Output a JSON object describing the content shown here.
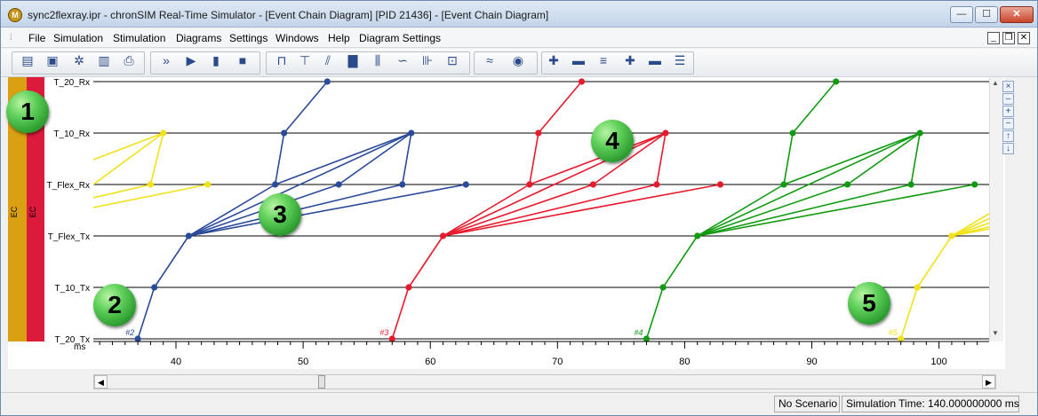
{
  "window": {
    "title": "sync2flexray.ipr - chronSIM Real-Time Simulator - [Event Chain Diagram] [PID 21436] - [Event Chain Diagram]",
    "app_icon_glyph": "M",
    "minimize": "—",
    "maximize": "☐",
    "close": "✕"
  },
  "menu": {
    "items": [
      "File",
      "Simulation",
      "Stimulation",
      "Diagrams",
      "Settings",
      "Windows",
      "Help",
      "Diagram Settings"
    ],
    "mdi_min": "_",
    "mdi_restore": "❐",
    "mdi_close": "✕"
  },
  "toolbar_icons": [
    "open-icon",
    "save-icon",
    "settings-icon",
    "report-icon",
    "print-icon",
    "fast-forward-icon",
    "step-icon",
    "pause-icon",
    "stop-icon",
    "chart-type-1-icon",
    "chart-type-2-icon",
    "chart-type-3-icon",
    "bar-chart-icon",
    "box-plot-icon",
    "curve-icon",
    "bracket-icon",
    "window-icon",
    "wave-icon",
    "eye-icon",
    "zoom-in-icon",
    "zoom-out-icon",
    "align-icon",
    "plus-icon",
    "minus-icon",
    "lines-icon"
  ],
  "side_buttons": [
    "×",
    "‒",
    "+",
    "−",
    "↑",
    "↓"
  ],
  "diagram": {
    "lane_labels": [
      "EC",
      "EC"
    ],
    "lane_colors": [
      "#d9a012",
      "#dc1a3c"
    ],
    "axis_unit": "ms",
    "rows": [
      "T_20_Rx",
      "T_10_Rx",
      "T_Flex_Rx",
      "T_Flex_Tx",
      "T_10_Tx",
      "T_20_Tx"
    ],
    "x_start": 33.5,
    "x_end": 104.5,
    "ticks": [
      40,
      50,
      60,
      70,
      80,
      90,
      100
    ],
    "chains": [
      {
        "label": "#2",
        "color": "#2a4a9a",
        "start": 37.0
      },
      {
        "label": "#3",
        "color": "#e81a2c",
        "start": 57.0
      },
      {
        "label": "#4",
        "color": "#109b10",
        "start": 77.0
      },
      {
        "label": "#5",
        "color": "#f2e21a",
        "start": 97.0
      }
    ],
    "yellow_left": {
      "color": "#f2e21a",
      "rx10": 39.0,
      "frx": [
        38.0,
        42.5
      ]
    }
  },
  "badges": [
    "1",
    "2",
    "3",
    "4",
    "5"
  ],
  "hscroll": {
    "left": "◀",
    "right": "▶"
  },
  "status": {
    "scenario": "No Scenario",
    "simulation_time": "Simulation Time: 140.000000000 ms"
  }
}
